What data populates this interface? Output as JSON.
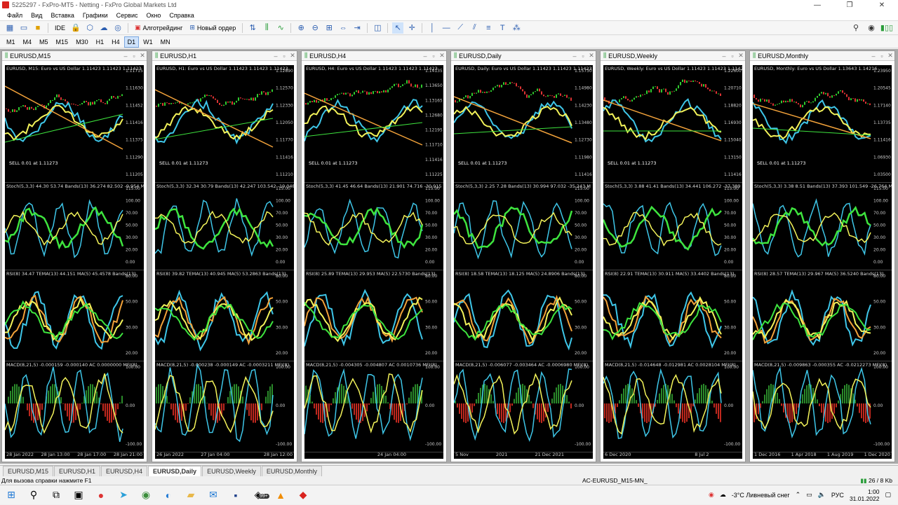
{
  "window": {
    "title": "5225297 - FxPro-MT5 - Netting - FxPro Global Markets Ltd"
  },
  "menu": [
    "Файл",
    "Вид",
    "Вставка",
    "Графики",
    "Сервис",
    "Окно",
    "Справка"
  ],
  "toolbar": {
    "algotrading": "Алготрейдинг",
    "new_order": "Новый ордер",
    "ide": "IDE"
  },
  "timeframes": [
    "M1",
    "M4",
    "M5",
    "M15",
    "M30",
    "H1",
    "H4",
    "D1",
    "W1",
    "MN"
  ],
  "active_timeframe": "D1",
  "charts": [
    {
      "title": "EURUSD,M15",
      "price_label": "EURUSD, M15:  Euro vs US Dollar  1.11423 1.11423 1.11423",
      "sell": "SELL 0.01 at 1.11273",
      "price_ticks": [
        "1.11715",
        "1.11630",
        "1.11452",
        "1.11416",
        "1.11375",
        "1.11290",
        "1.11205"
      ],
      "stoch": "Stoch(5,3,3) 44.30 53.74 Bands(13) 36.274 82.502 -9.954 M",
      "rsi": "RSI(8) 34.47 TEMA(13) 44.151 MA(5) 45.4578 Bands(13)",
      "macd": "MACD(8,21,5) -0.000159 -0.000140 AC 0.0000000 MFI(8)",
      "dates": [
        "28 Jan 2022",
        "28 Jan 13:00",
        "28 Jan 17:00",
        "28 Jan 21:00"
      ]
    },
    {
      "title": "EURUSD,H1",
      "price_label": "EURUSD, H1:  Euro vs US Dollar  1.11423 1.11423 1.11423",
      "sell": "SELL 0.01 at 1.11273",
      "price_ticks": [
        "1.12890",
        "1.12570",
        "1.12330",
        "1.12050",
        "1.11770",
        "1.11416",
        "1.11210"
      ],
      "stoch": "Stoch(5,3,3) 32.34 30.79 Bands(13) 42.247 103.542 -19.048",
      "rsi": "RSI(8) 39.82 TEMA(13) 40.945 MA(5) 53.2863 Bands(13)",
      "macd": "MACD(8,21,5) -0.000238 -0.000149 AC -0.0003211 MFI(8)",
      "dates": [
        "26 Jan 2022",
        "27 Jan 04:00",
        "",
        "28 Jan 12:00"
      ]
    },
    {
      "title": "EURUSD,H4",
      "price_label": "EURUSD, H4:  Euro vs US Dollar  1.11423 1.11423 1.11423",
      "sell": "SELL 0.01 at 1.11273",
      "price_ticks": [
        "1.14135",
        "1.13650",
        "1.13165",
        "1.12680",
        "1.12195",
        "1.11710",
        "1.11416",
        "1.11225"
      ],
      "stoch": "Stoch(5,3,3) 41.45 46.64 Bands(13) 21.901 74.716 -30.915",
      "rsi": "RSI(8) 25.89 TEMA(13) 29.953 MA(5) 22.5730 Bands(13)",
      "macd": "MACD(8,21,5) -0.004305 -0.004807 AC 0.0010736 MFI(8)",
      "dates": [
        "",
        "",
        "24 Jan 04:00",
        ""
      ]
    },
    {
      "title": "EURUSD,Daily",
      "price_label": "EURUSD, Daily:  Euro vs US Dollar  1.11423 1.11423 1.11423",
      "sell": "SELL 0.01 at 1.11273",
      "price_ticks": [
        "1.15730",
        "1.14980",
        "1.14230",
        "1.13480",
        "1.12730",
        "1.11980",
        "1.11416"
      ],
      "stoch": "Stoch(5,3,3) 2.25 7.28 Bands(13) 30.994 97.032 -35.243 M",
      "rsi": "RSI(8) 18.58 TEMA(13) 18.125 MA(5) 24.8906 Bands(13)",
      "macd": "MACD(8,21,5) -0.006077 -0.003464 AC -0.0006980 MFI(8)",
      "dates": [
        "5 Nov",
        "2021",
        "21 Dec 2021",
        ""
      ]
    },
    {
      "title": "EURUSD,Weekly",
      "price_label": "EURUSD, Weekly:  Euro vs US Dollar  1.11423 1.11423 1.11423",
      "sell": "SELL 0.01 at 1.11273",
      "price_ticks": [
        "1.22600",
        "1.20710",
        "1.18820",
        "1.16930",
        "1.15040",
        "1.13150",
        "1.11416"
      ],
      "stoch": "Stoch(5,3,3) 3.88 41.41 Bands(13) 34.441 106.272 -37.389",
      "rsi": "RSI(8) 22.91 TEMA(13) 30.911 MA(5) 33.4402 Bands(13)",
      "macd": "MACD(8,21,5) -0.014648 -0.012981 AC 0.0028104 MFI(8)",
      "dates": [
        "6 Dec 2020",
        "",
        "8 Jul 2",
        ""
      ]
    },
    {
      "title": "EURUSD,Monthly",
      "price_label": "EURUSD, Monthly:  Euro vs US Dollar  1.13643 1.14216",
      "sell": "SELL 0.01 at 1.11273",
      "price_ticks": [
        "1.23950",
        "1.20545",
        "1.17140",
        "1.13735",
        "1.11416",
        "1.06930",
        "1.03500"
      ],
      "stoch": "Stoch(5,3,3) 3.38 8.51 Bands(13) 37.393 101.549 -26.764 M",
      "rsi": "RSI(8) 28.57 TEMA(13) 29.967 MA(5) 36.5240 Bands(13)",
      "macd": "MACD(8,21,5) -0.009863 -0.000355 AC -0.0212273 MFI(8)",
      "dates": [
        "1 Dec 2016",
        "1 Apr 2018",
        "1 Aug 2019",
        "1 Dec 2020"
      ]
    }
  ],
  "tabs": [
    "EURUSD,M15",
    "EURUSD,H1",
    "EURUSD,H4",
    "EURUSD,Daily",
    "EURUSD,Weekly",
    "EURUSD,Monthly"
  ],
  "active_tab": "EURUSD,Daily",
  "status": {
    "help": "Для вызова справки нажмите F1",
    "profile": "AC-EURUSD_M15-MN_",
    "traffic": "26 / 8 Kb"
  },
  "taskbar": {
    "weather": "-3°C  Ливневый снег",
    "lang": "РУС",
    "time": "1:00",
    "date": "31.01.2022",
    "badge": "99+"
  },
  "colors": {
    "bg": "#000000",
    "cyan": "#3ec6e8",
    "yellow": "#f3f35a",
    "lime": "#3ee43e",
    "orange": "#f2a23a",
    "red": "#c0281e"
  }
}
